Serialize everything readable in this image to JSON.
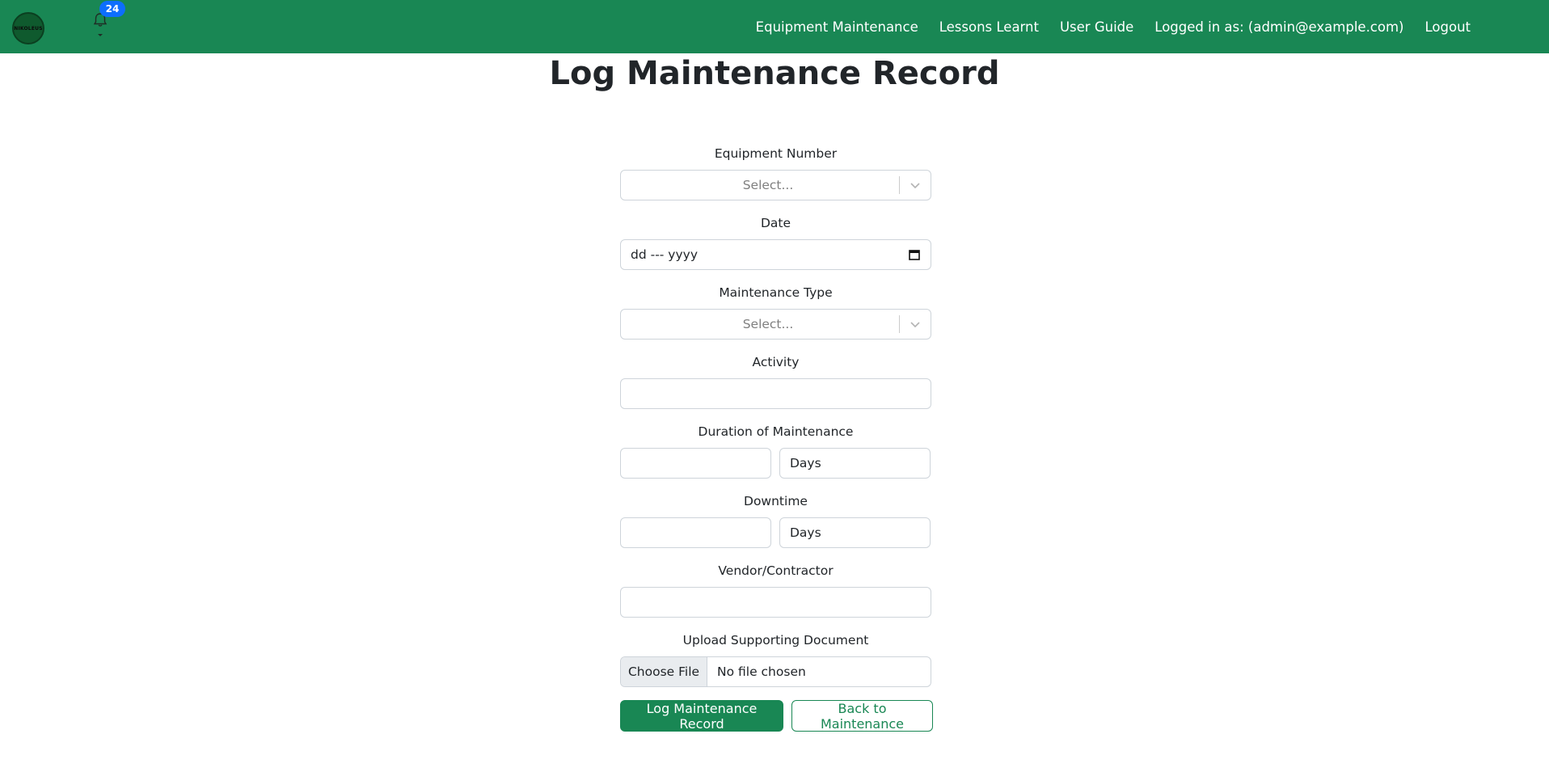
{
  "navbar": {
    "logo_text": "NIKOLEUS",
    "notification_count": "24",
    "links": [
      "Equipment Maintenance",
      "Lessons Learnt",
      "User Guide"
    ],
    "user_label": "Logged in as: (admin@example.com)",
    "logout": "Logout"
  },
  "page": {
    "title": "Log Maintenance Record"
  },
  "form": {
    "equipment_number": {
      "label": "Equipment Number",
      "placeholder": "Select..."
    },
    "date": {
      "label": "Date",
      "placeholder": "dd --- yyyy"
    },
    "maintenance_type": {
      "label": "Maintenance Type",
      "placeholder": "Select..."
    },
    "activity": {
      "label": "Activity",
      "value": ""
    },
    "duration": {
      "label": "Duration of Maintenance",
      "value": "",
      "unit": "Days"
    },
    "downtime": {
      "label": "Downtime",
      "value": "",
      "unit": "Days"
    },
    "vendor": {
      "label": "Vendor/Contractor",
      "value": ""
    },
    "upload": {
      "label": "Upload Supporting Document",
      "button": "Choose File",
      "status": "No file chosen"
    }
  },
  "actions": {
    "submit": "Log Maintenance Record",
    "back": "Back to Maintenance"
  },
  "colors": {
    "navbar": "#198754",
    "badge": "#0d6efd",
    "primary": "#198754"
  }
}
